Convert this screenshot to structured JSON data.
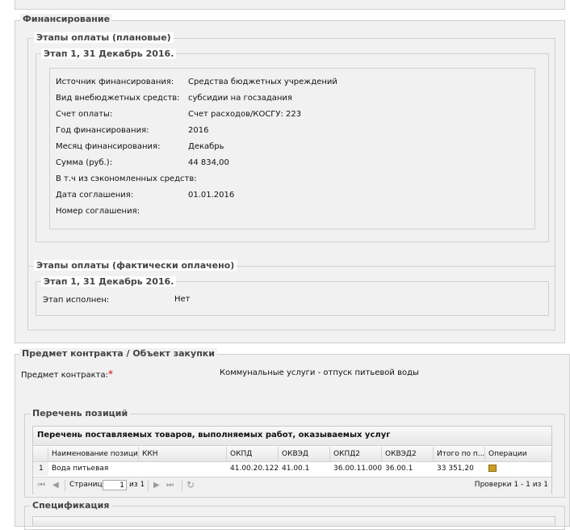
{
  "financing": {
    "legend": "Финансирование",
    "planned": {
      "legend": "Этапы оплаты (плановые)",
      "stage_legend": "Этап 1, 31 Декабрь 2016.",
      "rows": [
        {
          "label": "Источник финансирования:",
          "value": "Средства бюджетных учреждений"
        },
        {
          "label": "Вид внебюджетных средств:",
          "value": "субсидии на госзадания"
        },
        {
          "label": "Счет оплаты:",
          "value": "Счет расходов/КОСГУ: 223"
        },
        {
          "label": "Год финансирования:",
          "value": "2016"
        },
        {
          "label": "Месяц финансирования:",
          "value": "Декабрь"
        },
        {
          "label": "Сумма (руб.):",
          "value": "44 834,00"
        },
        {
          "label": "В т.ч из сэкономленных средств:",
          "value": ""
        },
        {
          "label": "Дата соглашения:",
          "value": "01.01.2016"
        },
        {
          "label": "Номер соглашения:",
          "value": ""
        }
      ]
    },
    "actual": {
      "legend": "Этапы оплаты (фактически оплачено)",
      "stage_legend": "Этап 1, 31 Декабрь 2016.",
      "executed_label": "Этап исполнен:",
      "executed_value": "Нет"
    }
  },
  "contract_subject": {
    "legend": "Предмет контракта / Объект закупки",
    "label": "Предмет контракта:",
    "required_mark": "*",
    "value": "Коммунальные услуги - отпуск питьевой воды"
  },
  "positions": {
    "legend": "Перечень позиций",
    "grid_title": "Перечень поставляемых товаров, выполняемых работ, оказываемых услуг",
    "columns": [
      "Наименование позиции",
      "ККН",
      "ОКПД",
      "ОКВЭД",
      "ОКПД2",
      "ОКВЭД2",
      "Итого по п...",
      "Операции"
    ],
    "rows": [
      {
        "num": "1",
        "name": "Вода питьевая",
        "kkn": "",
        "okpd": "41.00.20.122",
        "okved": "41.00.1",
        "okpd2": "36.00.11.000",
        "okved2": "36.00.1",
        "total": "33 351,20"
      }
    ],
    "pager": {
      "page_label": "Страница",
      "page_value": "1",
      "of_label": "из 1",
      "summary": "Проверки 1 - 1 из 1"
    }
  },
  "specification": {
    "legend": "Спецификация"
  },
  "colors": {
    "required": "#cc0000",
    "operations_icon": "#c8a020"
  }
}
